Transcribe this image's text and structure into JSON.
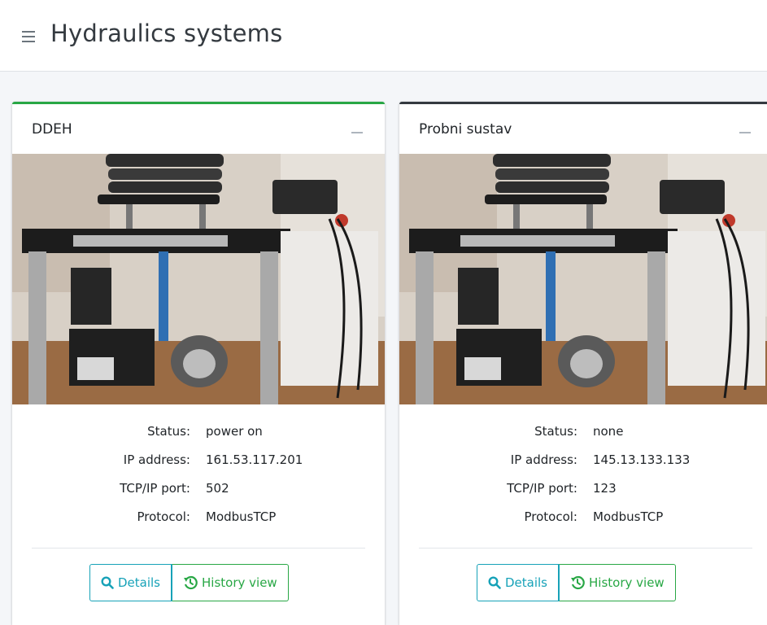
{
  "header": {
    "title": "Hydraulics systems",
    "menu_icon": "hamburger-menu-icon"
  },
  "colors": {
    "card_1_accent": "#28a745",
    "card_2_accent": "#343a40",
    "details_button": "#17a2b8",
    "history_button": "#28a745"
  },
  "cards": [
    {
      "name": "DDEH",
      "status_label": "Status:",
      "status": "power on",
      "ip_label": "IP address:",
      "ip": "161.53.117.201",
      "port_label": "TCP/IP port:",
      "port": "502",
      "protocol_label": "Protocol:",
      "protocol": "ModbusTCP",
      "details_label": "Details",
      "history_label": "History view"
    },
    {
      "name": "Probni sustav",
      "status_label": "Status:",
      "status": "none",
      "ip_label": "IP address:",
      "ip": "145.13.133.133",
      "port_label": "TCP/IP port:",
      "port": "123",
      "protocol_label": "Protocol:",
      "protocol": "ModbusTCP",
      "details_label": "Details",
      "history_label": "History view"
    }
  ]
}
